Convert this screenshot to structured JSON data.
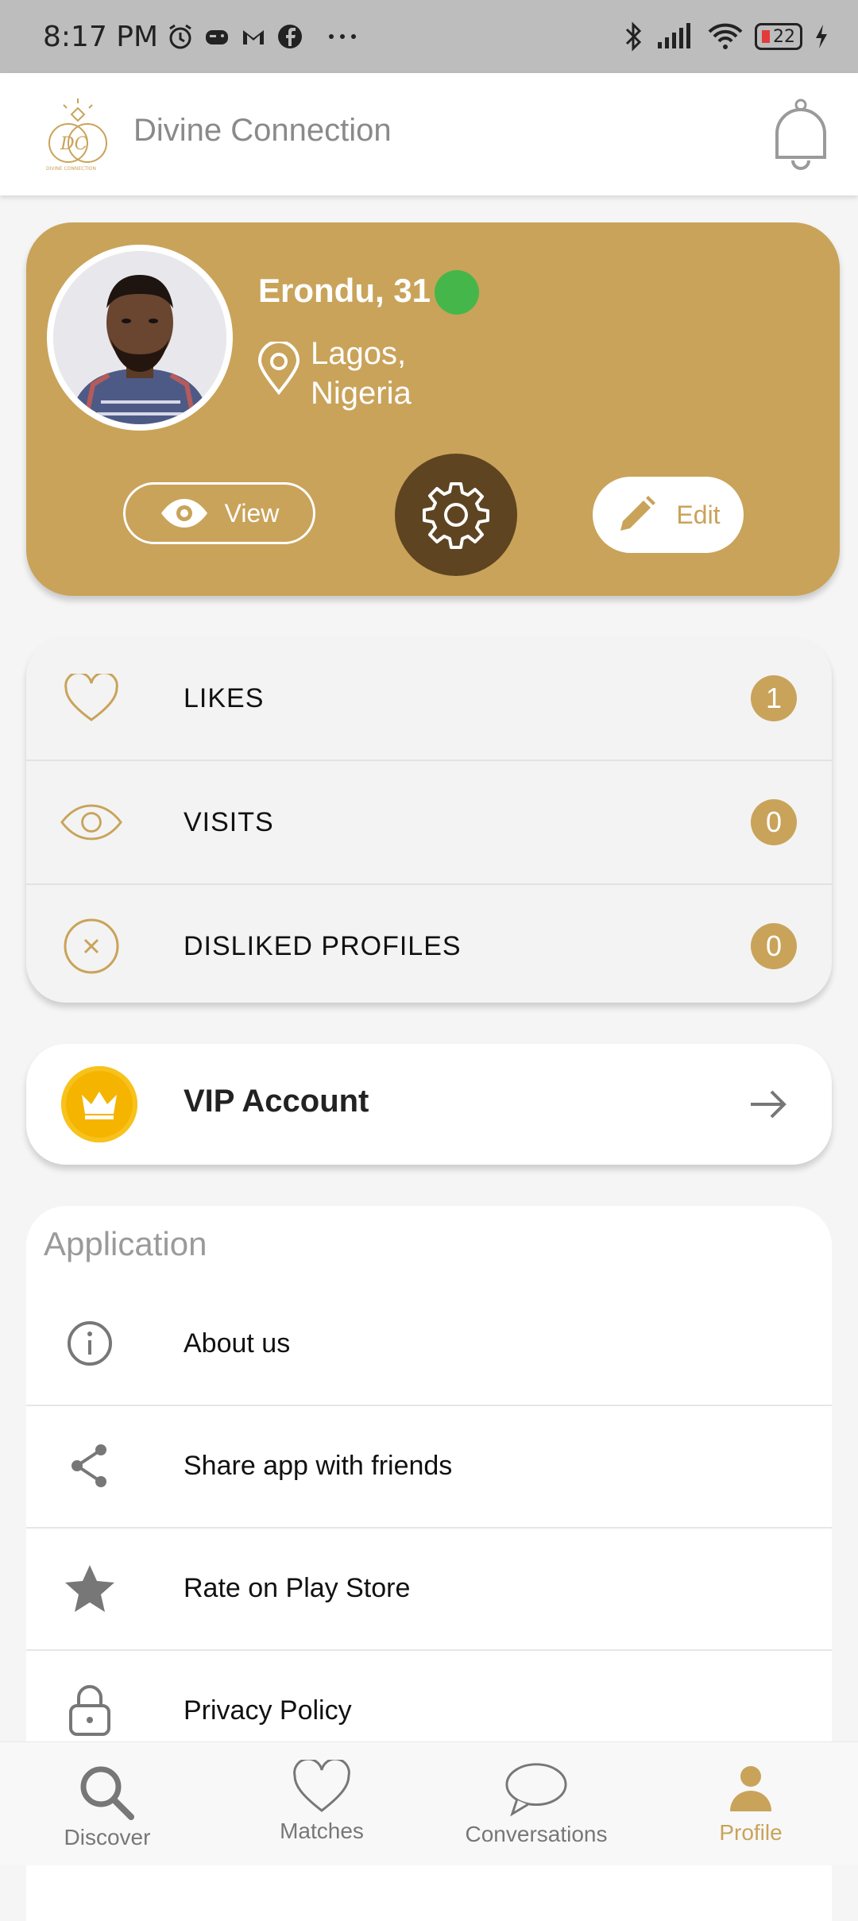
{
  "status_bar": {
    "time": "8:17 PM",
    "battery": "22",
    "icons": [
      "alarm-icon",
      "gamepad-icon",
      "gmail-icon",
      "facebook-icon",
      "more-icon",
      "bluetooth-icon",
      "signal-icon",
      "wifi-icon",
      "battery-icon",
      "charging-icon"
    ]
  },
  "app_bar": {
    "title": "Divine Connection",
    "logo_text": "DC",
    "logo_caption": "DIVINE CONNECTION",
    "notification_icon": "bell-icon"
  },
  "profile": {
    "name": "Erondu, 31",
    "online": true,
    "location_line1": "Lagos,",
    "location_line2": "Nigeria",
    "view_label": "View",
    "edit_label": "Edit"
  },
  "stats": [
    {
      "label": "LIKES",
      "count": "1",
      "icon": "heart-icon"
    },
    {
      "label": "VISITS",
      "count": "0",
      "icon": "eye-icon"
    },
    {
      "label": "DISLIKED PROFILES",
      "count": "0",
      "icon": "close-circle-icon"
    }
  ],
  "vip": {
    "label": "VIP Account",
    "icon": "crown-icon"
  },
  "application": {
    "title": "Application",
    "items": [
      {
        "label": "About us",
        "icon": "info-icon"
      },
      {
        "label": "Share app with friends",
        "icon": "share-icon"
      },
      {
        "label": "Rate on Play Store",
        "icon": "star-icon"
      },
      {
        "label": "Privacy Policy",
        "icon": "lock-icon"
      }
    ]
  },
  "bottom_nav": [
    {
      "label": "Discover",
      "icon": "search-icon",
      "active": false
    },
    {
      "label": "Matches",
      "icon": "heart-icon",
      "active": false
    },
    {
      "label": "Conversations",
      "icon": "chat-bubble-icon",
      "active": false
    },
    {
      "label": "Profile",
      "icon": "person-icon",
      "active": true
    }
  ],
  "colors": {
    "accent": "#c9a35a",
    "settings_button": "#5e4421",
    "online": "#45b74a",
    "vip_gold": "#f5b400"
  }
}
